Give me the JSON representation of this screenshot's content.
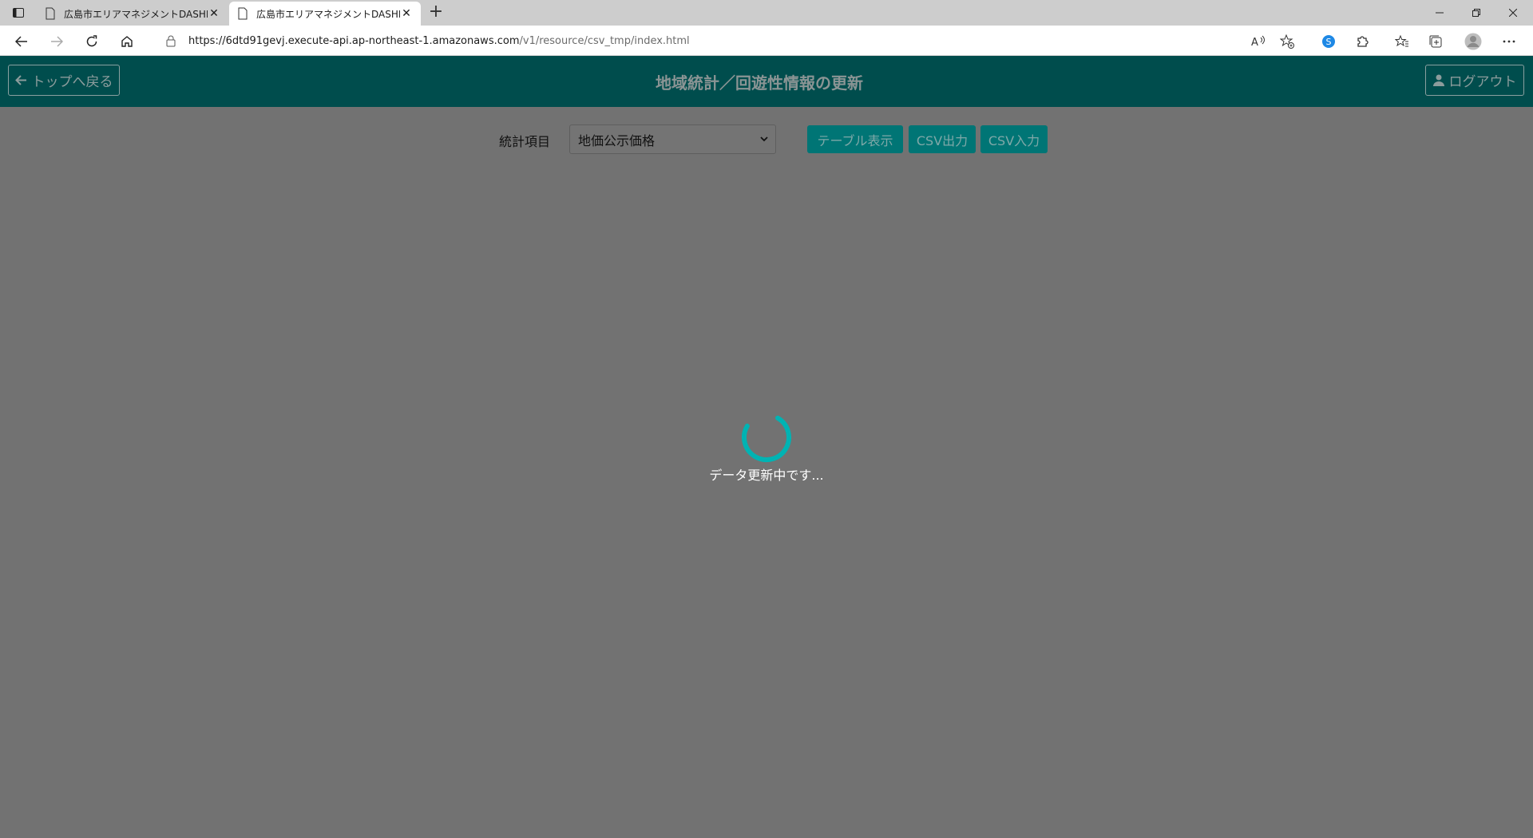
{
  "browser": {
    "tabs": [
      {
        "title": "広島市エリアマネジメントDASHBOARD",
        "active": false
      },
      {
        "title": "広島市エリアマネジメントDASHBOARD",
        "active": true
      }
    ],
    "url_host": "https://6dtd91gevj.execute-api.ap-northeast-1.amazonaws.com",
    "url_path": "/v1/resource/csv_tmp/index.html"
  },
  "header": {
    "back_label": "トップへ戻る",
    "title": "地域統計／回遊性情報の更新",
    "logout_label": "ログアウト"
  },
  "controls": {
    "stat_label": "統計項目",
    "stat_selected": "地価公示価格",
    "table_button": "テーブル表示",
    "csv_out_button": "CSV出力",
    "csv_in_button": "CSV入力"
  },
  "loading": {
    "message": "データ更新中です..."
  },
  "colors": {
    "appbar": "#004d4d",
    "button": "#007575",
    "spinner": "#00b3b3",
    "overlay": "#727272"
  }
}
